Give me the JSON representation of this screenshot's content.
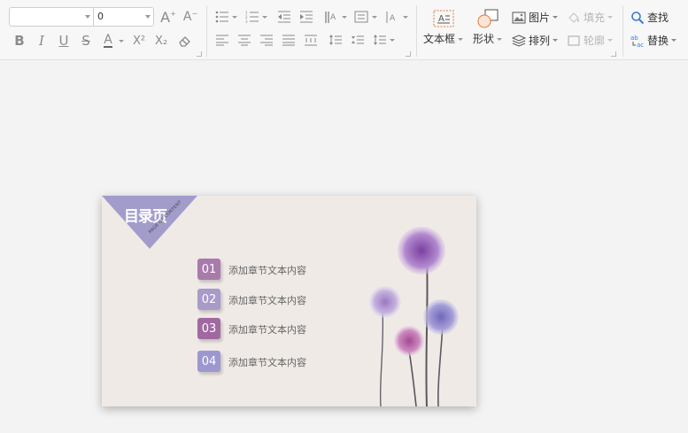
{
  "toolbar": {
    "font_name": "",
    "font_size": "0",
    "font_grow": "A",
    "font_shrink": "A",
    "superscript": "X²",
    "subscript": "X₂",
    "textbox_label": "文本框",
    "shape_label": "形状",
    "picture_label": "图片",
    "arrange_label": "排列",
    "fill_label": "填充",
    "outline_label": "轮廓",
    "find_label": "查找",
    "replace_label": "替换"
  },
  "slide": {
    "title": "目录页",
    "subtitle": "PAGE OF CONTENT",
    "items": [
      {
        "num": "01",
        "text": "添加章节文本内容",
        "color": "#a87bab"
      },
      {
        "num": "02",
        "text": "添加章节文本内容",
        "color": "#a89ac9"
      },
      {
        "num": "03",
        "text": "添加章节文本内容",
        "color": "#a06aa1"
      },
      {
        "num": "04",
        "text": "添加章节文本内容",
        "color": "#9c98cf"
      }
    ],
    "corner_color": "#a29ccb"
  }
}
